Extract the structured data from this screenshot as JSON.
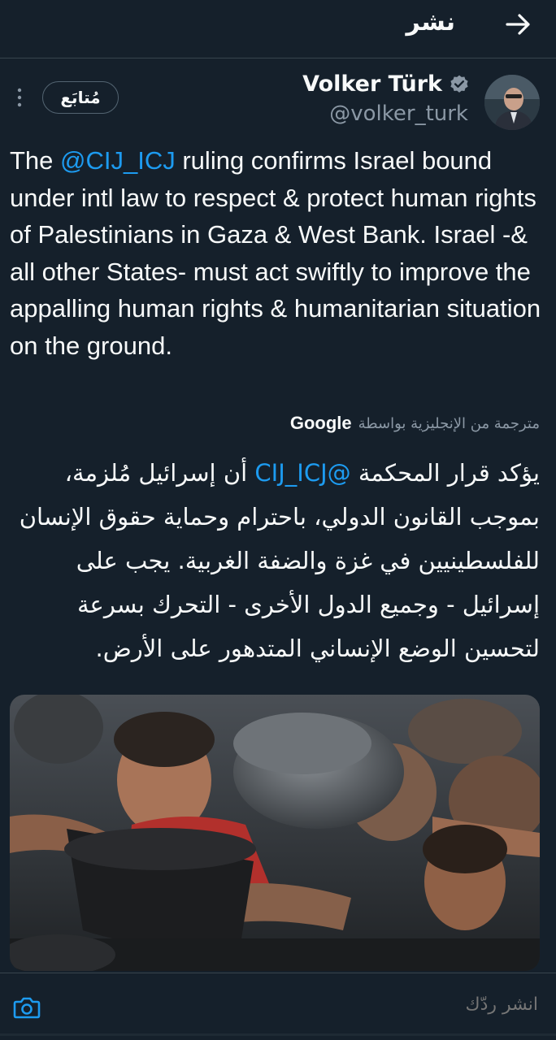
{
  "topbar": {
    "title": "نشر",
    "back_icon": "arrow-right-icon"
  },
  "author": {
    "name": "Volker Türk",
    "handle": "@volker_turk",
    "verified_icon": "verified-badge-icon",
    "follow_label": "مُتابَع",
    "more_icon": "more-vertical-icon"
  },
  "tweet": {
    "en_prefix": "The ",
    "en_mention": "@CIJ_ICJ",
    "en_rest": " ruling confirms Israel bound under intl law to respect & protect human rights of Palestinians in Gaza & West Bank. Israel -& all other States- must act swiftly to improve the appalling human rights & humanitarian situation on the ground.",
    "translated_label": "مترجمة من الإنجليزية بواسطة",
    "translated_by": "Google",
    "ar_prefix": "يؤكد قرار المحكمة ",
    "ar_mention": "@CIJ_ICJ",
    "ar_rest": " أن إسرائيل مُلزمة، بموجب القانون الدولي، باحترام وحماية حقوق الإنسان للفلسطينيين في غزة والضفة الغربية. يجب على إسرائيل - وجميع الدول الأخرى - التحرك بسرعة لتحسين الوضع الإنساني المتدهور على الأرض."
  },
  "reply": {
    "placeholder": "انشر ردّك",
    "camera_icon": "camera-icon"
  },
  "colors": {
    "background": "#15202b",
    "accent": "#1d9bf0",
    "muted": "#8b98a5"
  }
}
